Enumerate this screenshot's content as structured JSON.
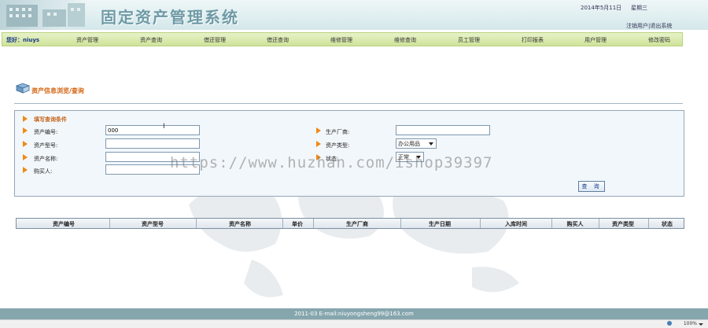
{
  "header": {
    "title": "固定资产管理系统",
    "date": "2014年5月11日",
    "weekday": "星期三",
    "links": [
      "注销用户",
      "退出系统"
    ],
    "link_separator": "|"
  },
  "nav": {
    "greeting": "您好：niuys",
    "items": [
      "资产管理",
      "资产查询",
      "借还管理",
      "借还查询",
      "维修管理",
      "维修查询",
      "员工管理",
      "打印报表",
      "用户管理",
      "修改密码"
    ]
  },
  "page": {
    "title": "资产信息浏览/查询"
  },
  "query": {
    "panel_title": "填写查询条件",
    "asset_no_label": "资产编号:",
    "asset_no_value": "000",
    "model_label": "资产型号:",
    "model_value": "",
    "name_label": "资产名称:",
    "name_value": "",
    "buyer_label": "购买人:",
    "buyer_value": "",
    "maker_label": "生产厂商:",
    "maker_value": "",
    "type_label": "资产类型:",
    "type_selected": "办公用品",
    "status_label": "状态:",
    "status_selected": "正常",
    "button_label": "查 询"
  },
  "table": {
    "columns": [
      "资产编号",
      "资产型号",
      "资产名称",
      "单价",
      "生产厂商",
      "生产日期",
      "入库时间",
      "购买人",
      "资产类型",
      "状态"
    ]
  },
  "watermark": "https://www.huzhan.com/ishop39397",
  "footer": {
    "text": "2011-03 E-mail:niuyongsheng99@163.com"
  },
  "statusbar": {
    "zoom": "100%"
  },
  "colors": {
    "nav_bg": "#cfe39a",
    "title_accent": "#d46410",
    "arrow": "#f08a14",
    "footer_bg": "#86a6ae"
  }
}
